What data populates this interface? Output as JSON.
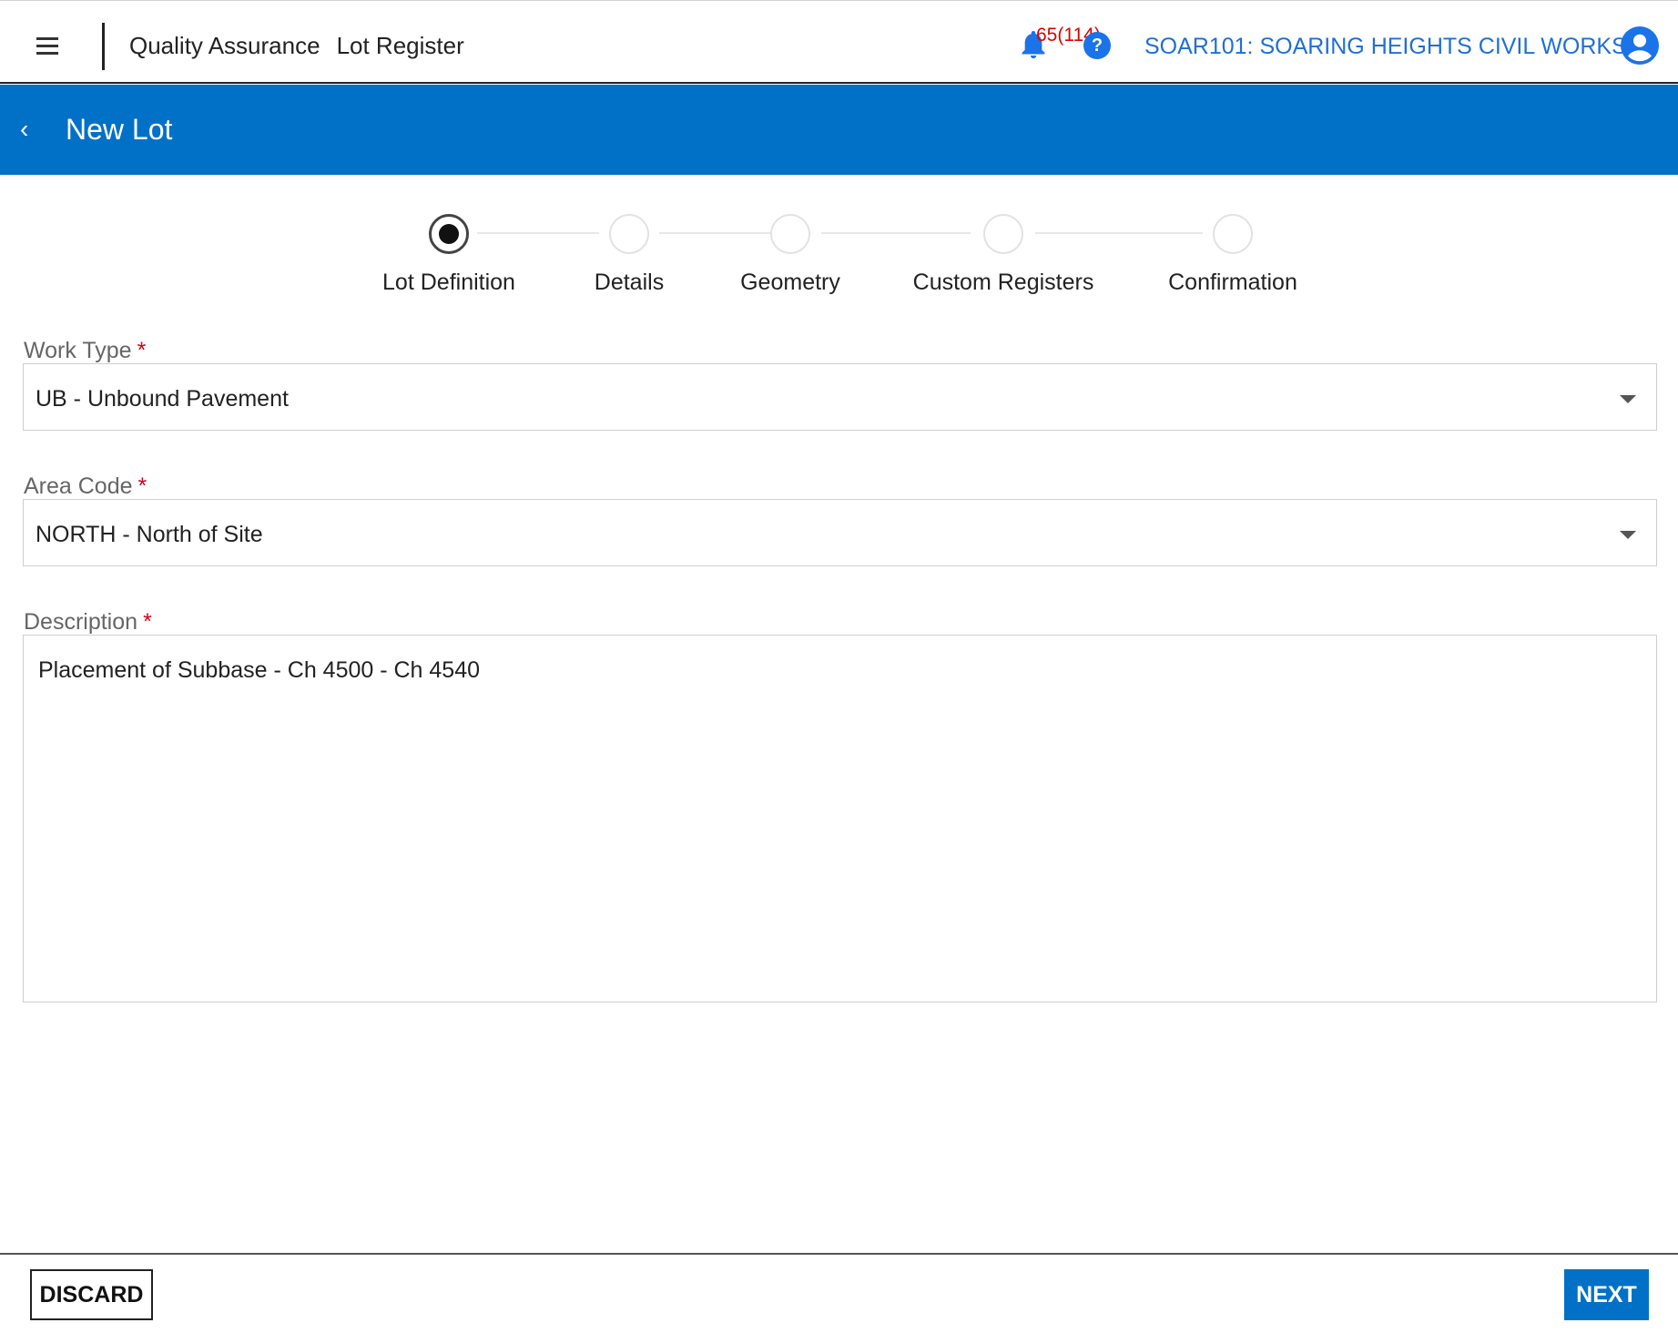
{
  "header": {
    "module": "Quality Assurance",
    "section": "Lot Register",
    "notification_count": "65(114)",
    "project": "SOAR101: SOARING HEIGHTS CIVIL WORKS"
  },
  "page": {
    "title": "New Lot"
  },
  "stepper": {
    "active_index": 0,
    "steps": [
      {
        "label": "Lot Definition"
      },
      {
        "label": "Details"
      },
      {
        "label": "Geometry"
      },
      {
        "label": "Custom Registers"
      },
      {
        "label": "Confirmation"
      }
    ]
  },
  "form": {
    "work_type": {
      "label": "Work Type",
      "required": "*",
      "value": "UB - Unbound Pavement"
    },
    "area_code": {
      "label": "Area Code",
      "required": "*",
      "value": "NORTH - North of Site"
    },
    "description": {
      "label": "Description",
      "required": "*",
      "value": "Placement of Subbase - Ch 4500 - Ch 4540"
    }
  },
  "footer": {
    "discard_label": "DISCARD",
    "next_label": "NEXT"
  },
  "colors": {
    "brand_blue": "#0071c7",
    "link_blue": "#1f6fd6",
    "required_red": "#d0021b",
    "notification_red": "#e00000"
  },
  "icons": [
    "menu-icon",
    "bell-icon",
    "help-icon",
    "account-icon",
    "back-chevron-icon",
    "dropdown-caret-icon"
  ]
}
